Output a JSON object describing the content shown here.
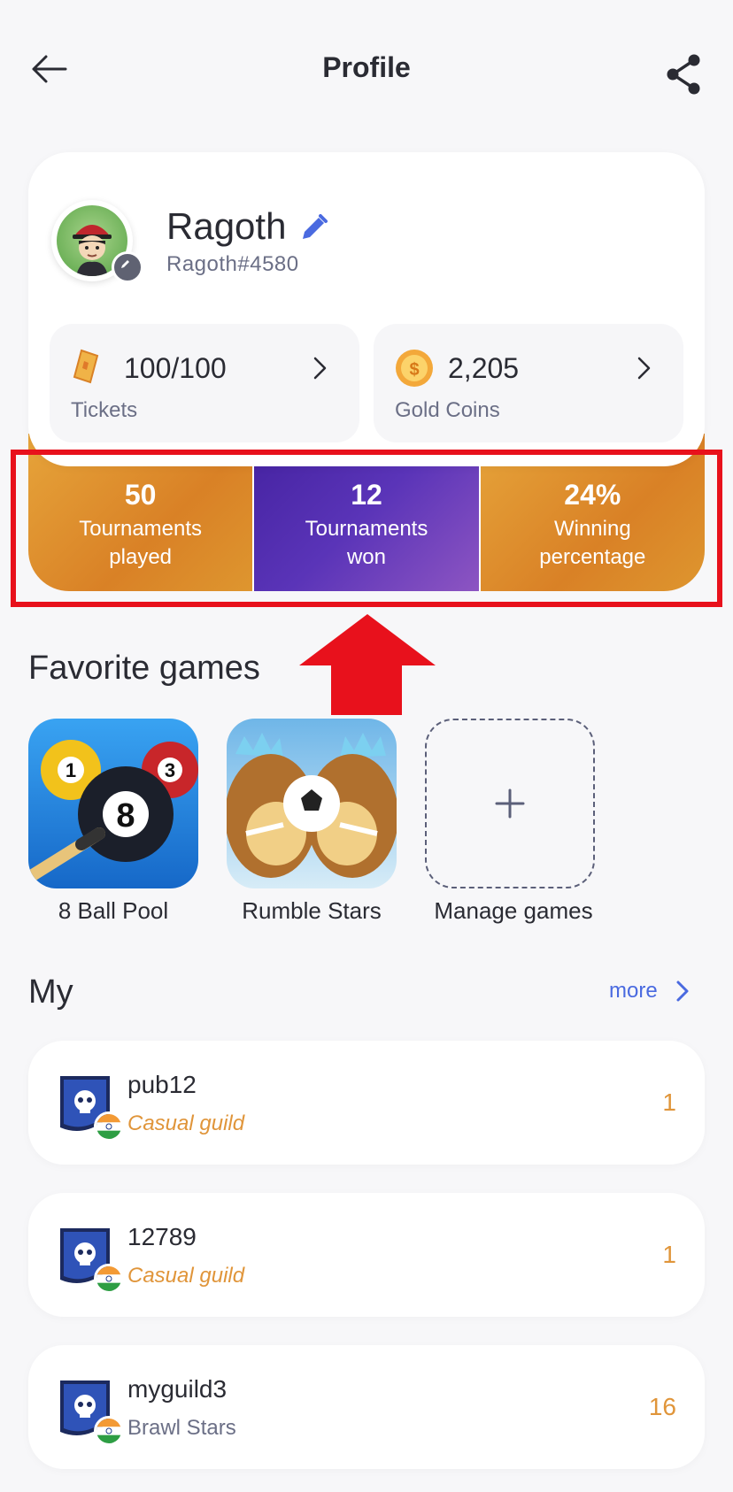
{
  "header": {
    "title": "Profile"
  },
  "profile": {
    "name": "Ragoth",
    "handle": "Ragoth#4580",
    "tickets": {
      "value": "100/100",
      "label": "Tickets"
    },
    "coins": {
      "value": "2,205",
      "label": "Gold Coins"
    }
  },
  "stats": [
    {
      "value": "50",
      "label_line1": "Tournaments",
      "label_line2": "played"
    },
    {
      "value": "12",
      "label_line1": "Tournaments",
      "label_line2": "won"
    },
    {
      "value": "24%",
      "label_line1": "Winning",
      "label_line2": "percentage"
    }
  ],
  "favorites": {
    "title": "Favorite games",
    "games": [
      {
        "label": "8 Ball Pool"
      },
      {
        "label": "Rumble Stars"
      }
    ],
    "manage_label": "Manage games"
  },
  "my": {
    "title": "My",
    "more_label": "more",
    "guilds": [
      {
        "name": "pub12",
        "sub": "Casual guild",
        "count": "1"
      },
      {
        "name": "12789",
        "sub": "Casual guild",
        "count": "1"
      },
      {
        "name": "myguild3",
        "sub": "Brawl Stars",
        "count": "16"
      }
    ]
  },
  "colors": {
    "accent_blue": "#4a6ae0",
    "orange": "#e0953a",
    "purple": "#4f2aa8",
    "highlight_red": "#e8111c"
  },
  "icons": [
    "back-arrow-icon",
    "share-icon",
    "pencil-icon",
    "ticket-icon",
    "gold-coin-icon",
    "chevron-right-icon",
    "plus-icon",
    "guild-shield-icon",
    "india-flag-icon"
  ]
}
